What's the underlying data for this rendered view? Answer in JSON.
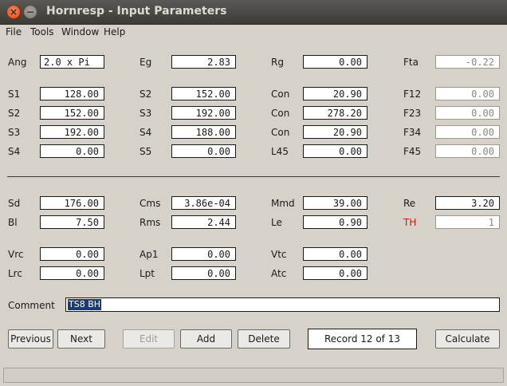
{
  "window": {
    "title": "Hornresp - Input Parameters"
  },
  "menu": [
    "File",
    "Tools",
    "Window",
    "Help"
  ],
  "fields": {
    "ang": {
      "label": "Ang",
      "value": "2.0 x Pi"
    },
    "eg": {
      "label": "Eg",
      "value": "2.83"
    },
    "rg": {
      "label": "Rg",
      "value": "0.00"
    },
    "fta": {
      "label": "Fta",
      "value": "-0.22"
    },
    "s1": {
      "label": "S1",
      "value": "128.00"
    },
    "s2a": {
      "label": "S2",
      "value": "152.00"
    },
    "con1": {
      "label": "Con",
      "value": "20.90"
    },
    "f12": {
      "label": "F12",
      "value": "0.00"
    },
    "s2": {
      "label": "S2",
      "value": "152.00"
    },
    "s3a": {
      "label": "S3",
      "value": "192.00"
    },
    "con2": {
      "label": "Con",
      "value": "278.20"
    },
    "f23": {
      "label": "F23",
      "value": "0.00"
    },
    "s3": {
      "label": "S3",
      "value": "192.00"
    },
    "s4a": {
      "label": "S4",
      "value": "188.00"
    },
    "con3": {
      "label": "Con",
      "value": "20.90"
    },
    "f34": {
      "label": "F34",
      "value": "0.00"
    },
    "s4": {
      "label": "S4",
      "value": "0.00"
    },
    "s5": {
      "label": "S5",
      "value": "0.00"
    },
    "l45": {
      "label": "L45",
      "value": "0.00"
    },
    "f45": {
      "label": "F45",
      "value": "0.00"
    },
    "sd": {
      "label": "Sd",
      "value": "176.00"
    },
    "cms": {
      "label": "Cms",
      "value": "3.86e-04"
    },
    "mmd": {
      "label": "Mmd",
      "value": "39.00"
    },
    "re": {
      "label": "Re",
      "value": "3.20"
    },
    "bl": {
      "label": "Bl",
      "value": "7.50"
    },
    "rms": {
      "label": "Rms",
      "value": "2.44"
    },
    "le": {
      "label": "Le",
      "value": "0.90"
    },
    "th": {
      "label": "TH",
      "value": "1"
    },
    "vrc": {
      "label": "Vrc",
      "value": "0.00"
    },
    "ap1": {
      "label": "Ap1",
      "value": "0.00"
    },
    "vtc": {
      "label": "Vtc",
      "value": "0.00"
    },
    "lrc": {
      "label": "Lrc",
      "value": "0.00"
    },
    "lpt": {
      "label": "Lpt",
      "value": "0.00"
    },
    "atc": {
      "label": "Atc",
      "value": "0.00"
    }
  },
  "comment": {
    "label": "Comment",
    "value": "TS8 BH"
  },
  "buttons": {
    "previous": "Previous",
    "next": "Next",
    "edit": "Edit",
    "add": "Add",
    "delete": "Delete",
    "calculate": "Calculate"
  },
  "record": "Record 12 of 13",
  "colors": {
    "titlebar": "#3c3b37",
    "background": "#d6d2ca",
    "th_label": "#d9120f",
    "selection": "#1d3b6e"
  }
}
